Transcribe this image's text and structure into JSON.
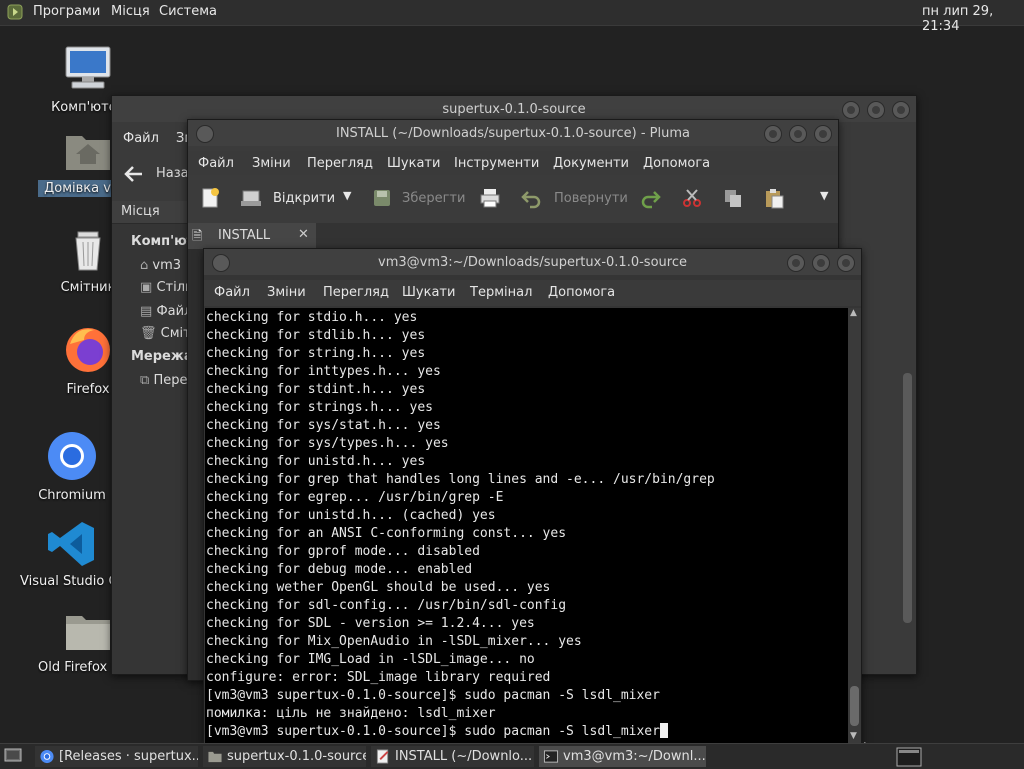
{
  "top_panel": {
    "menus": [
      "Програми",
      "Місця",
      "Система"
    ],
    "clock": "пн лип 29, 21:34"
  },
  "desktop": {
    "icons": [
      {
        "label": "Комп'ютер",
        "icon": "computer-icon"
      },
      {
        "label": "Домівка vm3",
        "icon": "home-folder-icon",
        "selected": true
      },
      {
        "label": "Смітник",
        "icon": "trash-icon"
      },
      {
        "label": "Firefox",
        "icon": "firefox-icon"
      },
      {
        "label": "Chromium",
        "icon": "chromium-icon"
      },
      {
        "label": "Visual Studio Code",
        "icon": "vscode-icon"
      },
      {
        "label": "Old Firefox Data",
        "icon": "folder-icon"
      }
    ]
  },
  "file_manager": {
    "title": "supertux-0.1.0-source",
    "menus": [
      "Файл",
      "Зм"
    ],
    "back_label": "Назад",
    "places_header": "Місця",
    "sidebar": {
      "computer_header": "Комп'ютер",
      "items": [
        "vm3",
        "Стільниця",
        "Файлова система",
        "Смітник"
      ],
      "network_header": "Мережа",
      "network_items": [
        "Переглянути мережу"
      ]
    }
  },
  "pluma": {
    "title": "INSTALL (~/Downloads/supertux-0.1.0-source) - Pluma",
    "menus": [
      "Файл",
      "Зміни",
      "Перегляд",
      "Шукати",
      "Інструменти",
      "Документи",
      "Допомога"
    ],
    "toolbar": {
      "open_label": "Відкрити",
      "save_label": "Зберегти",
      "revert_label": "Повернути"
    },
    "tab_label": "INSTALL"
  },
  "terminal": {
    "title": "vm3@vm3:~/Downloads/supertux-0.1.0-source",
    "menus": [
      "Файл",
      "Зміни",
      "Перегляд",
      "Шукати",
      "Термінал",
      "Допомога"
    ],
    "lines": [
      "checking for stdio.h... yes",
      "checking for stdlib.h... yes",
      "checking for string.h... yes",
      "checking for inttypes.h... yes",
      "checking for stdint.h... yes",
      "checking for strings.h... yes",
      "checking for sys/stat.h... yes",
      "checking for sys/types.h... yes",
      "checking for unistd.h... yes",
      "checking for grep that handles long lines and -e... /usr/bin/grep",
      "checking for egrep... /usr/bin/grep -E",
      "checking for unistd.h... (cached) yes",
      "checking for an ANSI C-conforming const... yes",
      "checking for gprof mode... disabled",
      "checking for debug mode... enabled",
      "checking wether OpenGL should be used... yes",
      "checking for sdl-config... /usr/bin/sdl-config",
      "checking for SDL - version >= 1.2.4... yes",
      "checking for Mix_OpenAudio in -lSDL_mixer... yes",
      "checking for IMG_Load in -lSDL_image... no",
      "configure: error: SDL_image library required",
      "[vm3@vm3 supertux-0.1.0-source]$ sudo pacman -S lsdl_mixer",
      "помилка: ціль не знайдено: lsdl_mixer"
    ],
    "prompt_line": "[vm3@vm3 supertux-0.1.0-source]$ sudo pacman -S lsdl_mixer"
  },
  "taskbar": {
    "tasks": [
      {
        "label": "[Releases · supertux...",
        "icon": "chromium-icon"
      },
      {
        "label": "supertux-0.1.0-source",
        "icon": "folder-icon"
      },
      {
        "label": "INSTALL (~/Downlo...",
        "icon": "text-editor-icon"
      },
      {
        "label": "vm3@vm3:~/Downl...",
        "icon": "terminal-icon",
        "active": true
      }
    ]
  }
}
